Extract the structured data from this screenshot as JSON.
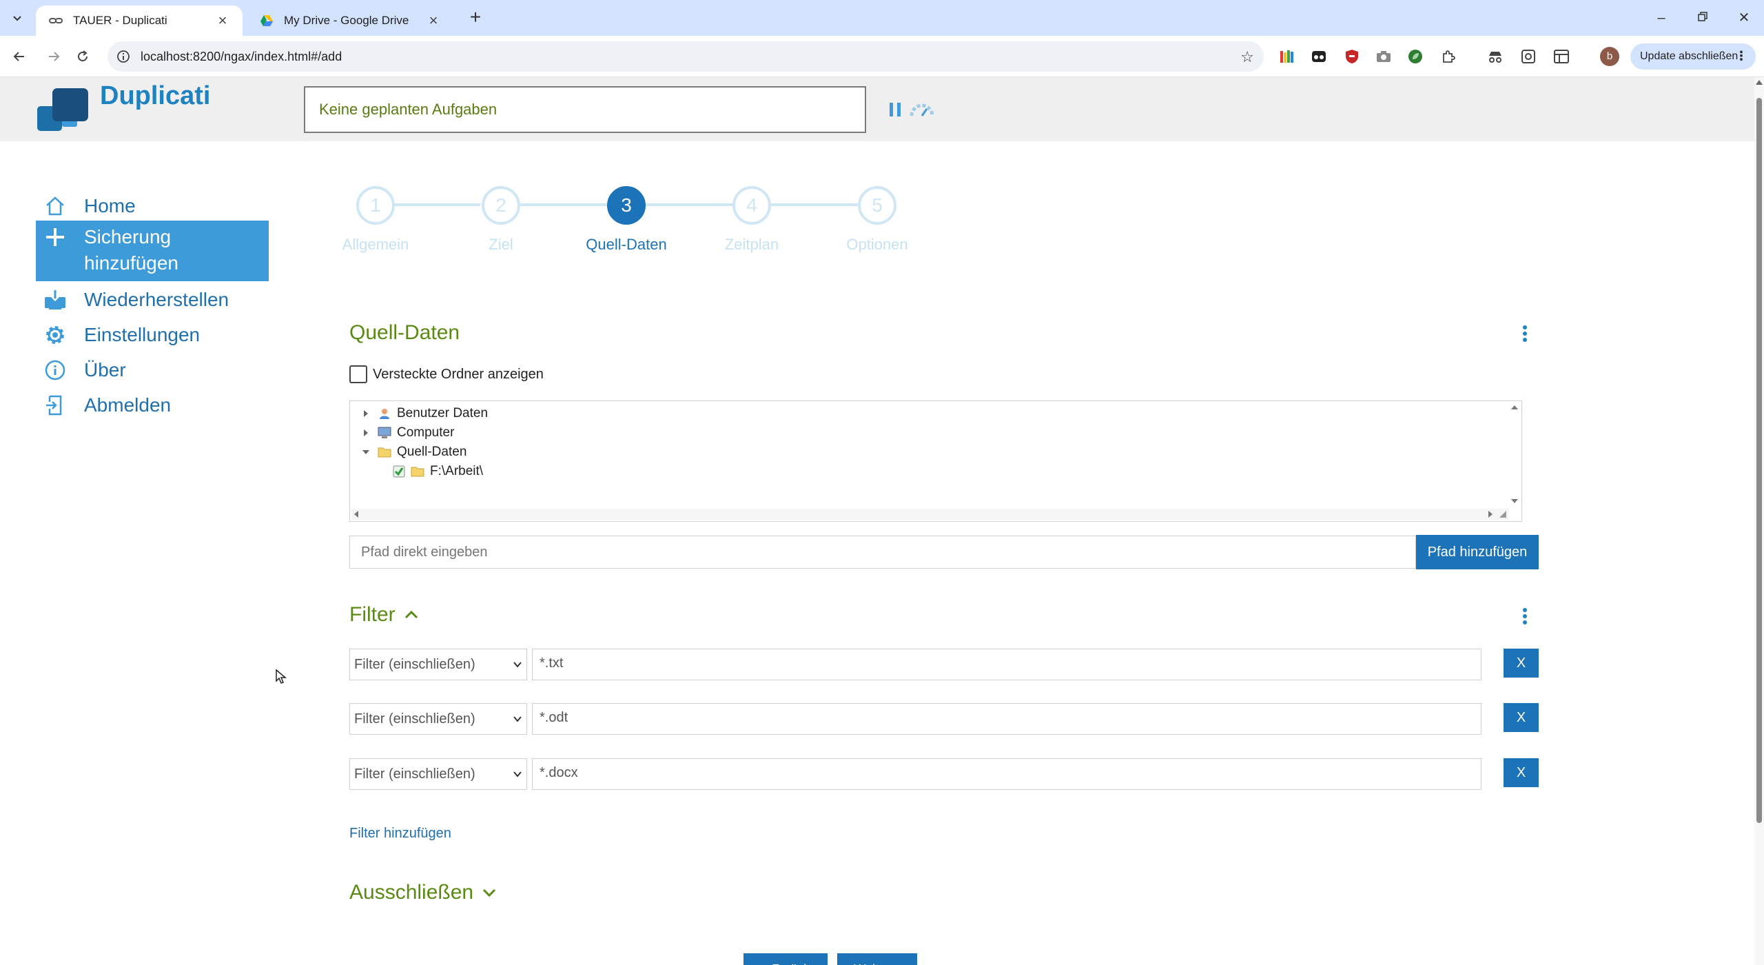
{
  "browser": {
    "tabs": [
      {
        "title": "TAUER - Duplicati",
        "active": true
      },
      {
        "title": "My Drive - Google Drive",
        "active": false
      }
    ],
    "url": "localhost:8200/ngax/index.html#/add",
    "update_label": "Update abschließen",
    "profile_initial": "b"
  },
  "app": {
    "name": "Duplicati",
    "status": "Keine geplanten Aufgaben"
  },
  "sidebar": {
    "items": [
      {
        "label": "Home",
        "icon": "home-icon",
        "active": false
      },
      {
        "label": "Sicherung hinzufügen",
        "icon": "plus-icon",
        "active": true
      },
      {
        "label": "Wiederherstellen",
        "icon": "restore-icon",
        "active": false
      },
      {
        "label": "Einstellungen",
        "icon": "gear-icon",
        "active": false
      },
      {
        "label": "Über",
        "icon": "info-icon",
        "active": false
      },
      {
        "label": "Abmelden",
        "icon": "logout-icon",
        "active": false
      }
    ]
  },
  "wizard": {
    "current_step": 3,
    "steps": [
      {
        "number": "1",
        "label": "Allgemein"
      },
      {
        "number": "2",
        "label": "Ziel"
      },
      {
        "number": "3",
        "label": "Quell-Daten"
      },
      {
        "number": "4",
        "label": "Zeitplan"
      },
      {
        "number": "5",
        "label": "Optionen"
      }
    ],
    "back_label": "< Zurück",
    "next_label": "Weiter >"
  },
  "source": {
    "title": "Quell-Daten",
    "show_hidden_label": "Versteckte Ordner anzeigen",
    "show_hidden_checked": false,
    "tree": [
      {
        "label": "Benutzer Daten",
        "icon": "user-folder-icon",
        "expanded": false
      },
      {
        "label": "Computer",
        "icon": "computer-icon",
        "expanded": false
      },
      {
        "label": "Quell-Daten",
        "icon": "folder-icon",
        "expanded": true
      },
      {
        "label": "F:\\Arbeit\\",
        "icon": "folder-icon",
        "checked": true
      }
    ],
    "path_placeholder": "Pfad direkt eingeben",
    "add_path_label": "Pfad hinzufügen"
  },
  "filter": {
    "title": "Filter",
    "rows": [
      {
        "type": "Filter (einschließen)",
        "value": "*.txt"
      },
      {
        "type": "Filter (einschließen)",
        "value": "*.odt"
      },
      {
        "type": "Filter (einschließen)",
        "value": "*.docx"
      }
    ],
    "remove_label": "X",
    "add_label": "Filter hinzufügen"
  },
  "exclude": {
    "title": "Ausschließen"
  },
  "colors": {
    "accent": "#1c73b8",
    "sidebar_active": "#3e9bd9",
    "section_title": "#5a8a12",
    "step_inactive": "#cfe6f4"
  }
}
